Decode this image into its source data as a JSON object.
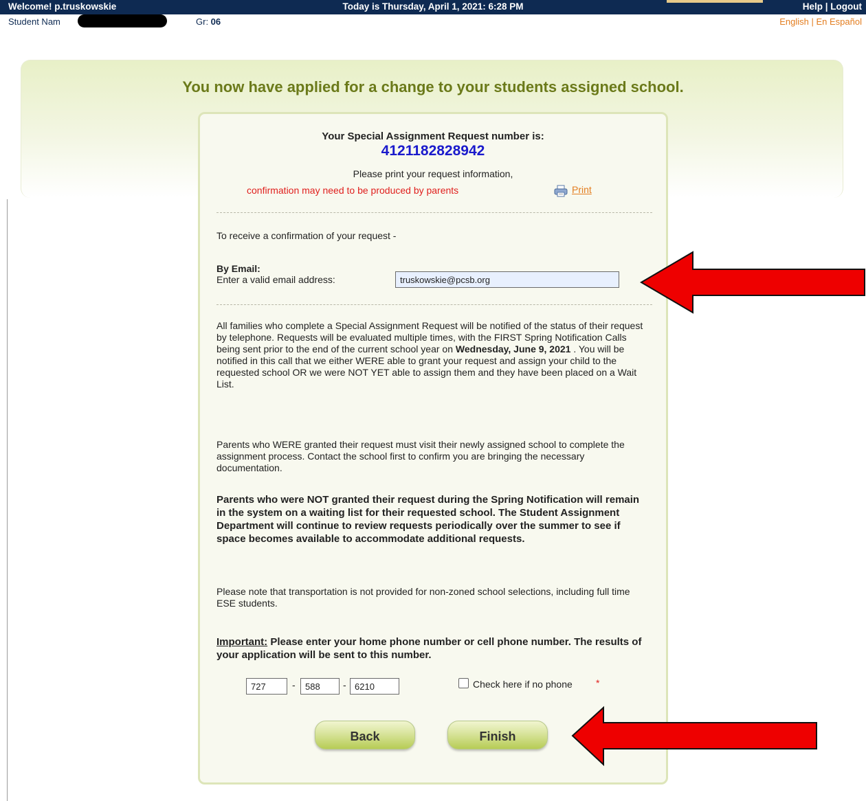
{
  "topbar": {
    "welcome": "Welcome! p.truskowskie",
    "today": "Today is Thursday, April 1, 2021: 6:28 PM",
    "help": "Help",
    "separator": " | ",
    "logout": "Logout"
  },
  "subbar": {
    "student_label": "Student Nam",
    "grade_label": "Gr: ",
    "grade_value": "06",
    "lang_english": "English",
    "lang_separator": " | ",
    "lang_spanish": "En Español"
  },
  "headline": "You now have applied for a change to your students assigned school.",
  "request": {
    "label": "Your Special Assignment Request number is:",
    "number": "4121182828942",
    "print_instruction": "Please print your request information,",
    "warning": "confirmation may need to be produced by parents",
    "print_link": "Print"
  },
  "confirmation": {
    "intro": "To receive a confirmation of your request -",
    "by_email": "By Email:",
    "email_prompt": "Enter a valid email address:",
    "email_value": "truskowskie@pcsb.org"
  },
  "body": {
    "para1_a": "All families who complete a Special Assignment Request will be notified of the status of their request by telephone. Requests will be evaluated multiple times, with the FIRST Spring Notification Calls being sent prior to the end of the current school year on ",
    "para1_date": "Wednesday, June 9, 2021",
    "para1_b": " . You will be notified in this call that we either WERE able to grant your request and assign your child to the requested school OR we were NOT YET able to assign them and they have been placed on a Wait List.",
    "para2": "Parents who WERE granted their request must visit their newly assigned school to complete the assignment process. Contact the school first to confirm you are bringing the necessary documentation.",
    "para3": "Parents who were NOT granted their request during the Spring Notification will remain in the system on a waiting list for their requested school. The Student Assignment Department will continue to review requests periodically over the summer to see if space becomes available to accommodate additional requests.",
    "para4": "Please note that transportation is not provided for non-zoned school selections, including full time ESE students."
  },
  "phone": {
    "important_label": "Important:",
    "important_text": " Please enter your home phone number or cell phone number. The results of your application will be sent to this number.",
    "area": "727",
    "prefix": "588",
    "line": "6210",
    "dash": "-",
    "no_phone_label": "Check here if no phone",
    "required_mark": "*"
  },
  "buttons": {
    "back": "Back",
    "finish": "Finish"
  },
  "colors": {
    "topbar": "#0e2a52",
    "accent_orange": "#e37d1f",
    "headline": "#6b7a1a",
    "request_number": "#1a1acc",
    "warning": "#e0201e",
    "annotation_arrow": "#ee0000"
  },
  "icons": {
    "print": "printer-icon",
    "annotation": "red-arrow-icon"
  }
}
